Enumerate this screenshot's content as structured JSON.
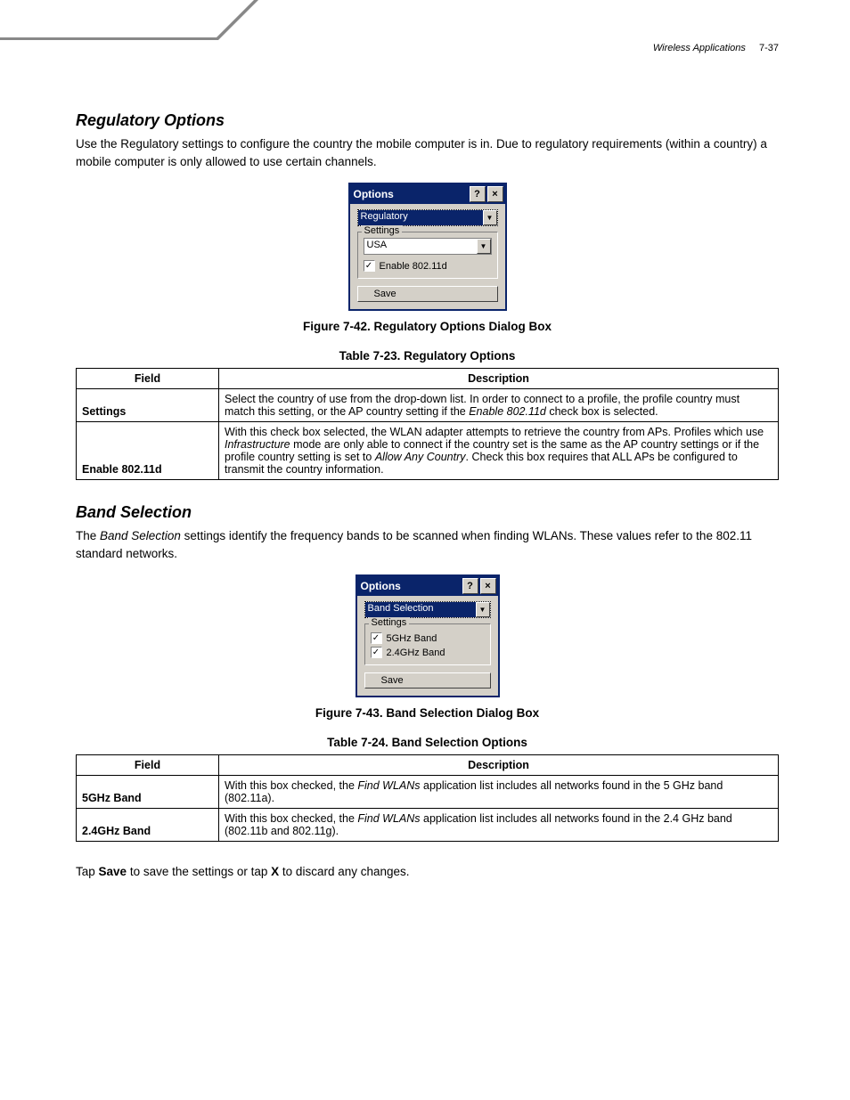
{
  "header": {
    "chapter": "Wireless Applications",
    "page": "7-37"
  },
  "s1": {
    "heading": "Regulatory Options",
    "para": "Use the Regulatory settings to configure the country the mobile computer is in. Due to regulatory requirements (within a country) a mobile computer is only allowed to use certain channels.",
    "dialog": {
      "title": "Options",
      "combo": "Regulatory",
      "fieldset_legend": "Settings",
      "country_combo": "USA",
      "checkbox": "Enable 802.11d",
      "save": "Save"
    },
    "fig_caption": "Figure 7-42.  Regulatory Options Dialog Box",
    "tbl_caption": "Table 7-23. Regulatory Options",
    "th_field": "Field",
    "th_desc": "Description",
    "rows": [
      {
        "field": "Settings",
        "desc_pre": "Select the country of use from the drop-down list. In order to connect to a profile, the profile country must match this setting, or the AP country setting if the ",
        "desc_ital": "Enable 802.11d",
        "desc_post": " check box is selected."
      },
      {
        "field": "Enable 802.11d",
        "desc_pre": "With this check box selected, the WLAN adapter attempts to retrieve the country from APs. Profiles which use ",
        "desc_ital": "Infrastructure",
        "desc_mid": " mode are only able to connect if the country set is the same as the AP country settings or if the profile country setting is set to ",
        "desc_ital2": "Allow Any Country",
        "desc_post": ". Check this box requires that ALL APs be configured to transmit the country information."
      }
    ]
  },
  "s2": {
    "heading": "Band Selection",
    "para_pre": "The ",
    "para_ital": "Band Selection",
    "para_post": " settings identify the frequency bands to be scanned when finding WLANs. These values refer to the 802.11 standard networks.",
    "dialog": {
      "title": "Options",
      "combo": "Band Selection",
      "fieldset_legend": "Settings",
      "chk1": "5GHz Band",
      "chk2": "2.4GHz Band",
      "save": "Save"
    },
    "fig_caption": "Figure 7-43.  Band Selection Dialog Box",
    "tbl_caption": "Table 7-24. Band Selection Options",
    "th_field": "Field",
    "th_desc": "Description",
    "rows": [
      {
        "field": "5GHz Band",
        "desc_pre": "With this box checked, the ",
        "desc_ital": "Find WLANs",
        "desc_post": " application list includes all networks found in the 5 GHz band (802.11a)."
      },
      {
        "field": "2.4GHz Band",
        "desc_pre": "With this box checked, the ",
        "desc_ital": "Find WLANs",
        "desc_post": " application list includes all networks found in the 2.4 GHz band (802.11b and 802.11g)."
      }
    ]
  },
  "final_pre": "Tap ",
  "final_b1": "Save",
  "final_mid": " to save the settings or tap ",
  "final_b2": "X",
  "final_post": " to discard any changes."
}
